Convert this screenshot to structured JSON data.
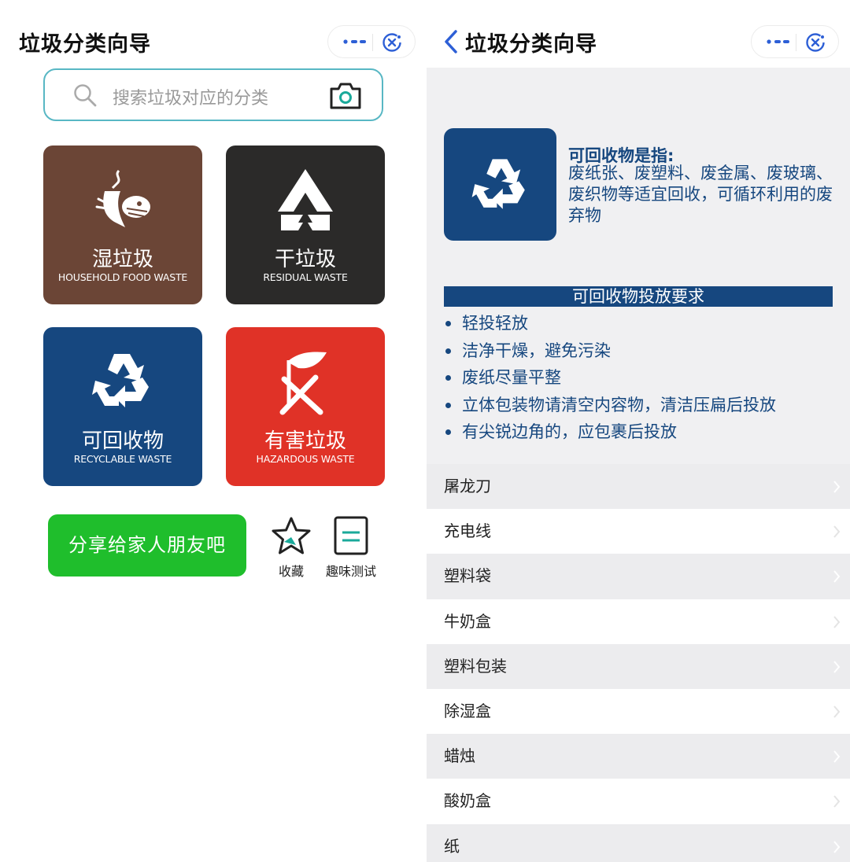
{
  "left": {
    "title": "垃圾分类向导",
    "search": {
      "placeholder": "搜索垃圾对应的分类"
    },
    "tiles": [
      {
        "cn": "湿垃圾",
        "en": "HOUSEHOLD FOOD WASTE",
        "color": "#6b4536"
      },
      {
        "cn": "干垃圾",
        "en": "RESIDUAL WASTE",
        "color": "#2b2a29"
      },
      {
        "cn": "可回收物",
        "en": "RECYCLABLE WASTE",
        "color": "#16477f"
      },
      {
        "cn": "有害垃圾",
        "en": "HAZARDOUS WASTE",
        "color": "#e03227"
      }
    ],
    "share_label": "分享给家人朋友吧",
    "actions": {
      "favorite": "收藏",
      "quiz": "趣味测试"
    }
  },
  "right": {
    "title": "垃圾分类向导",
    "definition": {
      "title": "可回收物是指:",
      "body": "废纸张、废塑料、废金属、废玻璃、废织物等适宜回收，可循环利用的废弃物"
    },
    "requirements": {
      "title": "可回收物投放要求",
      "items": [
        "轻投轻放",
        "洁净干燥，避免污染",
        "废纸尽量平整",
        "立体包装物请清空内容物，清洁压扁后投放",
        "有尖锐边角的，应包裹后投放"
      ]
    },
    "list": [
      "屠龙刀",
      "充电线",
      "塑料袋",
      "牛奶盒",
      "塑料包装",
      "除湿盒",
      "蜡烛",
      "酸奶盒",
      "纸"
    ]
  },
  "colors": {
    "accent_blue": "#16477f",
    "search_border": "#58b7c4",
    "share_green": "#1fbe2c",
    "capsule_blue": "#2d5fd6"
  },
  "icons": {
    "more": "more-dots-icon",
    "close": "close-miniprogram-icon",
    "back": "chevron-left-icon",
    "search": "search-icon",
    "camera": "camera-icon",
    "recycle": "recycle-icon",
    "favorite": "star-icon",
    "quiz": "document-icon"
  }
}
